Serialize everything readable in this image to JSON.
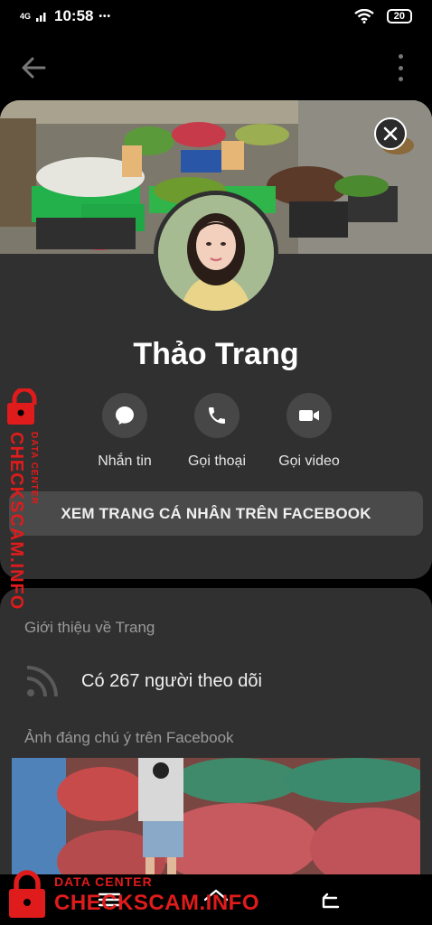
{
  "status_bar": {
    "network": "4G",
    "time": "10:58",
    "dots": "•••",
    "battery": "20"
  },
  "profile": {
    "name": "Thảo Trang",
    "actions": [
      {
        "label": "Nhắn tin",
        "icon": "message-icon"
      },
      {
        "label": "Gọi thoại",
        "icon": "phone-icon"
      },
      {
        "label": "Gọi video",
        "icon": "video-camera-icon"
      }
    ],
    "facebook_button": "XEM TRANG CÁ NHÂN TRÊN FACEBOOK"
  },
  "about": {
    "title": "Giới thiệu về Trang",
    "followers": "Có 267 người theo dõi",
    "photos_title": "Ảnh đáng chú ý trên Facebook"
  },
  "watermark": {
    "small": "DATA CENTER",
    "big": "CHECKSCAM.INFO"
  },
  "colors": {
    "background": "#000000",
    "card": "#303030",
    "button": "#4a4a4a",
    "watermark": "#e01b1b"
  }
}
